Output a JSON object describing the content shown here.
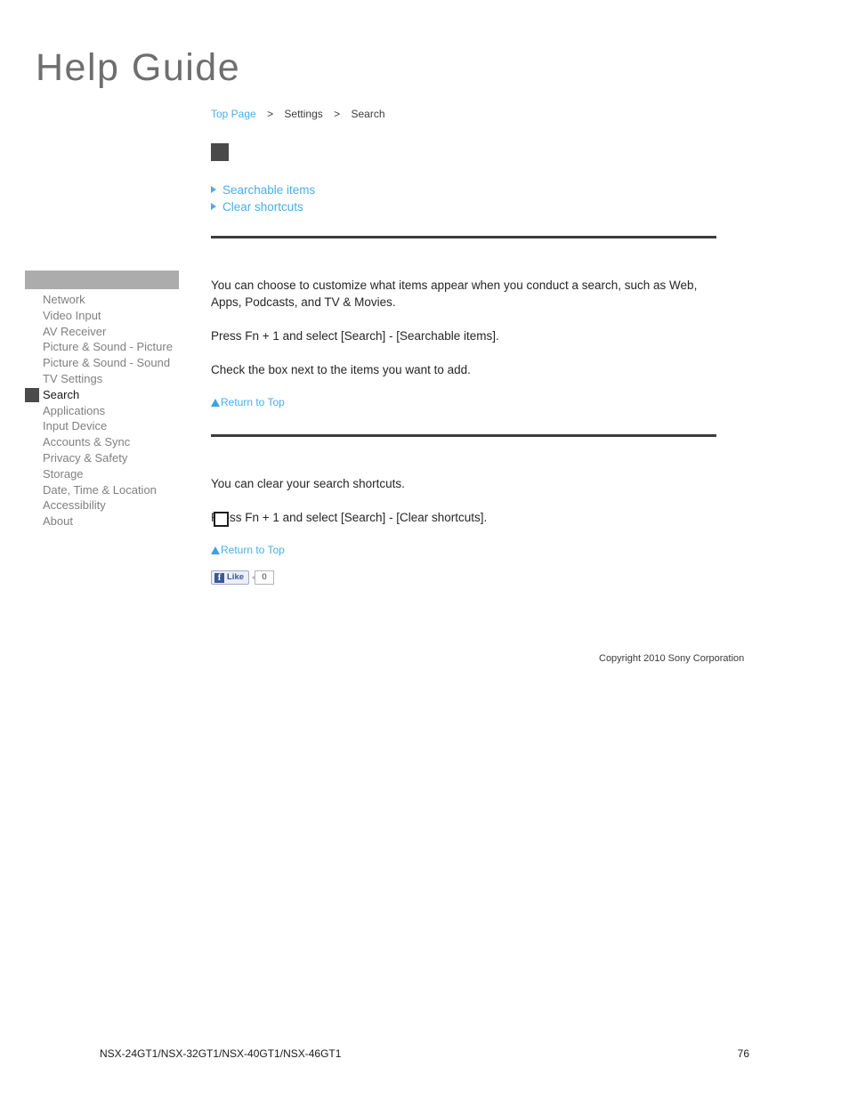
{
  "masthead": {
    "title": "Help Guide"
  },
  "breadcrumb": {
    "items": [
      {
        "label": "Top Page",
        "is_link": true
      },
      {
        "label": "Settings",
        "is_link": false
      },
      {
        "label": "Search",
        "is_link": false
      }
    ],
    "separator": ">"
  },
  "sidebar": {
    "header_label": "",
    "items": [
      {
        "label": "Network",
        "active": false
      },
      {
        "label": "Video Input",
        "active": false
      },
      {
        "label": "AV Receiver",
        "active": false
      },
      {
        "label": "Picture & Sound - Picture",
        "active": false
      },
      {
        "label": "Picture & Sound - Sound",
        "active": false
      },
      {
        "label": "TV Settings",
        "active": false
      },
      {
        "label": "Search",
        "active": true
      },
      {
        "label": "Applications",
        "active": false
      },
      {
        "label": "Input Device",
        "active": false
      },
      {
        "label": "Accounts & Sync",
        "active": false
      },
      {
        "label": "Privacy & Safety",
        "active": false
      },
      {
        "label": "Storage",
        "active": false
      },
      {
        "label": "Date, Time & Location",
        "active": false
      },
      {
        "label": "Accessibility",
        "active": false
      },
      {
        "label": "About",
        "active": false
      }
    ]
  },
  "toc": {
    "items": [
      {
        "label": "Searchable items"
      },
      {
        "label": "Clear shortcuts"
      }
    ]
  },
  "sections": [
    {
      "paragraphs": [
        "You can choose to customize what items appear when you conduct a search, such as Web, Apps, Podcasts, and TV & Movies.",
        "Press Fn + 1 and select [Search] - [Searchable items].",
        "Check the box next to the items you want to add."
      ],
      "return_to_top": "Return to Top"
    },
    {
      "paragraphs": [
        "You can clear your search shortcuts.",
        "Press Fn + 1 and select [Search] - [Clear shortcuts]."
      ],
      "return_to_top": "Return to Top"
    }
  ],
  "social": {
    "facebook_glyph": "f",
    "like_label": "Like",
    "like_count": "0"
  },
  "copyright": "Copyright 2010 Sony Corporation",
  "page_footer": {
    "models": "NSX-24GT1/NSX-32GT1/NSX-40GT1/NSX-46GT1",
    "page_number": "76"
  },
  "colors": {
    "link_blue": "#4aadea",
    "rule_dark": "#3c3c3c",
    "sidebar_header_gray": "#acacac",
    "active_marker_gray": "#4a4a4a",
    "sidebar_text_gray": "#808080"
  }
}
